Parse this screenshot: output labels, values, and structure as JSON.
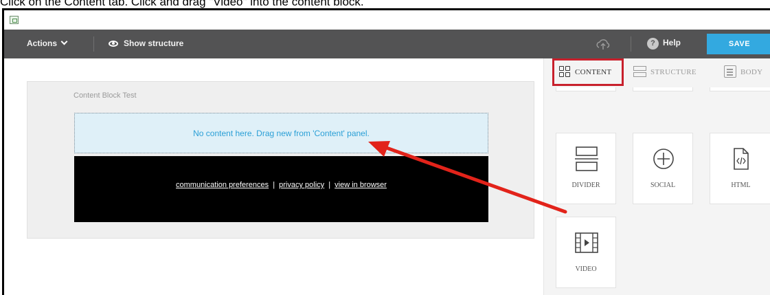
{
  "instruction": "Click on the Content tab. Click and drag \"Video\" into the content block.",
  "toolbar": {
    "actions_label": "Actions",
    "show_structure_label": "Show structure",
    "help_label": "Help",
    "help_icon_glyph": "?",
    "save_label": "SAVE"
  },
  "canvas": {
    "block_title": "Content Block Test",
    "dropzone_text": "No content here. Drag new from 'Content' panel.",
    "footer_links": [
      "communication preferences",
      "privacy policy",
      "view in browser"
    ],
    "footer_separator": "|"
  },
  "panel": {
    "tabs": [
      {
        "label": "CONTENT",
        "active": true
      },
      {
        "label": "STRUCTURE",
        "active": false
      },
      {
        "label": "BODY",
        "active": false
      }
    ],
    "tiles": [
      {
        "label": "DIVIDER",
        "icon": "divider-icon"
      },
      {
        "label": "SOCIAL",
        "icon": "social-plus-icon"
      },
      {
        "label": "HTML",
        "icon": "html-file-icon"
      },
      {
        "label": "VIDEO",
        "icon": "video-film-icon"
      }
    ]
  },
  "annotation": {
    "arrow_color": "#e2231a",
    "highlight_color": "#c8202c"
  },
  "colors": {
    "toolbar": "#535354",
    "save_button": "#33a9e0",
    "dropzone_text": "#2a9fd6"
  }
}
